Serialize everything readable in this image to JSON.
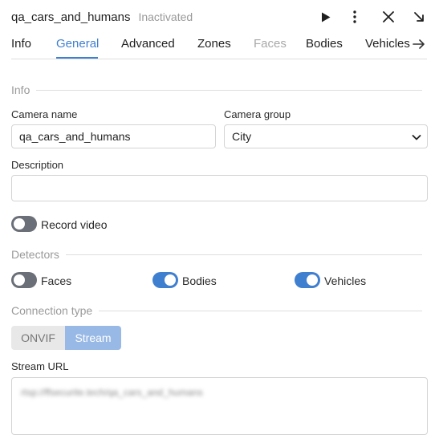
{
  "header": {
    "camera_title": "qa_cars_and_humans",
    "status": "Inactivated",
    "icons": [
      "play-icon",
      "more-vertical-icon",
      "close-icon",
      "collapse-icon"
    ]
  },
  "tabs": [
    {
      "label": "Info",
      "state": "normal"
    },
    {
      "label": "General",
      "state": "active"
    },
    {
      "label": "Advanced",
      "state": "normal"
    },
    {
      "label": "Zones",
      "state": "normal"
    },
    {
      "label": "Faces",
      "state": "disabled"
    },
    {
      "label": "Bodies",
      "state": "normal"
    },
    {
      "label": "Vehicles",
      "state": "normal"
    }
  ],
  "info_section": {
    "title": "Info",
    "camera_name_label": "Camera name",
    "camera_name_value": "qa_cars_and_humans",
    "camera_group_label": "Camera group",
    "camera_group_value": "City",
    "description_label": "Description",
    "description_value": "",
    "record_video_label": "Record video",
    "record_video_enabled": false
  },
  "detectors_section": {
    "title": "Detectors",
    "items": [
      {
        "label": "Faces",
        "enabled": false
      },
      {
        "label": "Bodies",
        "enabled": true
      },
      {
        "label": "Vehicles",
        "enabled": true
      }
    ]
  },
  "connection_section": {
    "title": "Connection type",
    "options": [
      "ONVIF",
      "Stream"
    ],
    "selected": "Stream",
    "stream_url_label": "Stream URL",
    "stream_url_value": "rtsp://ffsecurite.tech/qa_cars_and_humans"
  },
  "colors": {
    "accent": "#3f7fd0",
    "toggle_off": "#6b6f78",
    "segment_active": "#98b9e6",
    "muted_text": "#9a9a9a"
  }
}
